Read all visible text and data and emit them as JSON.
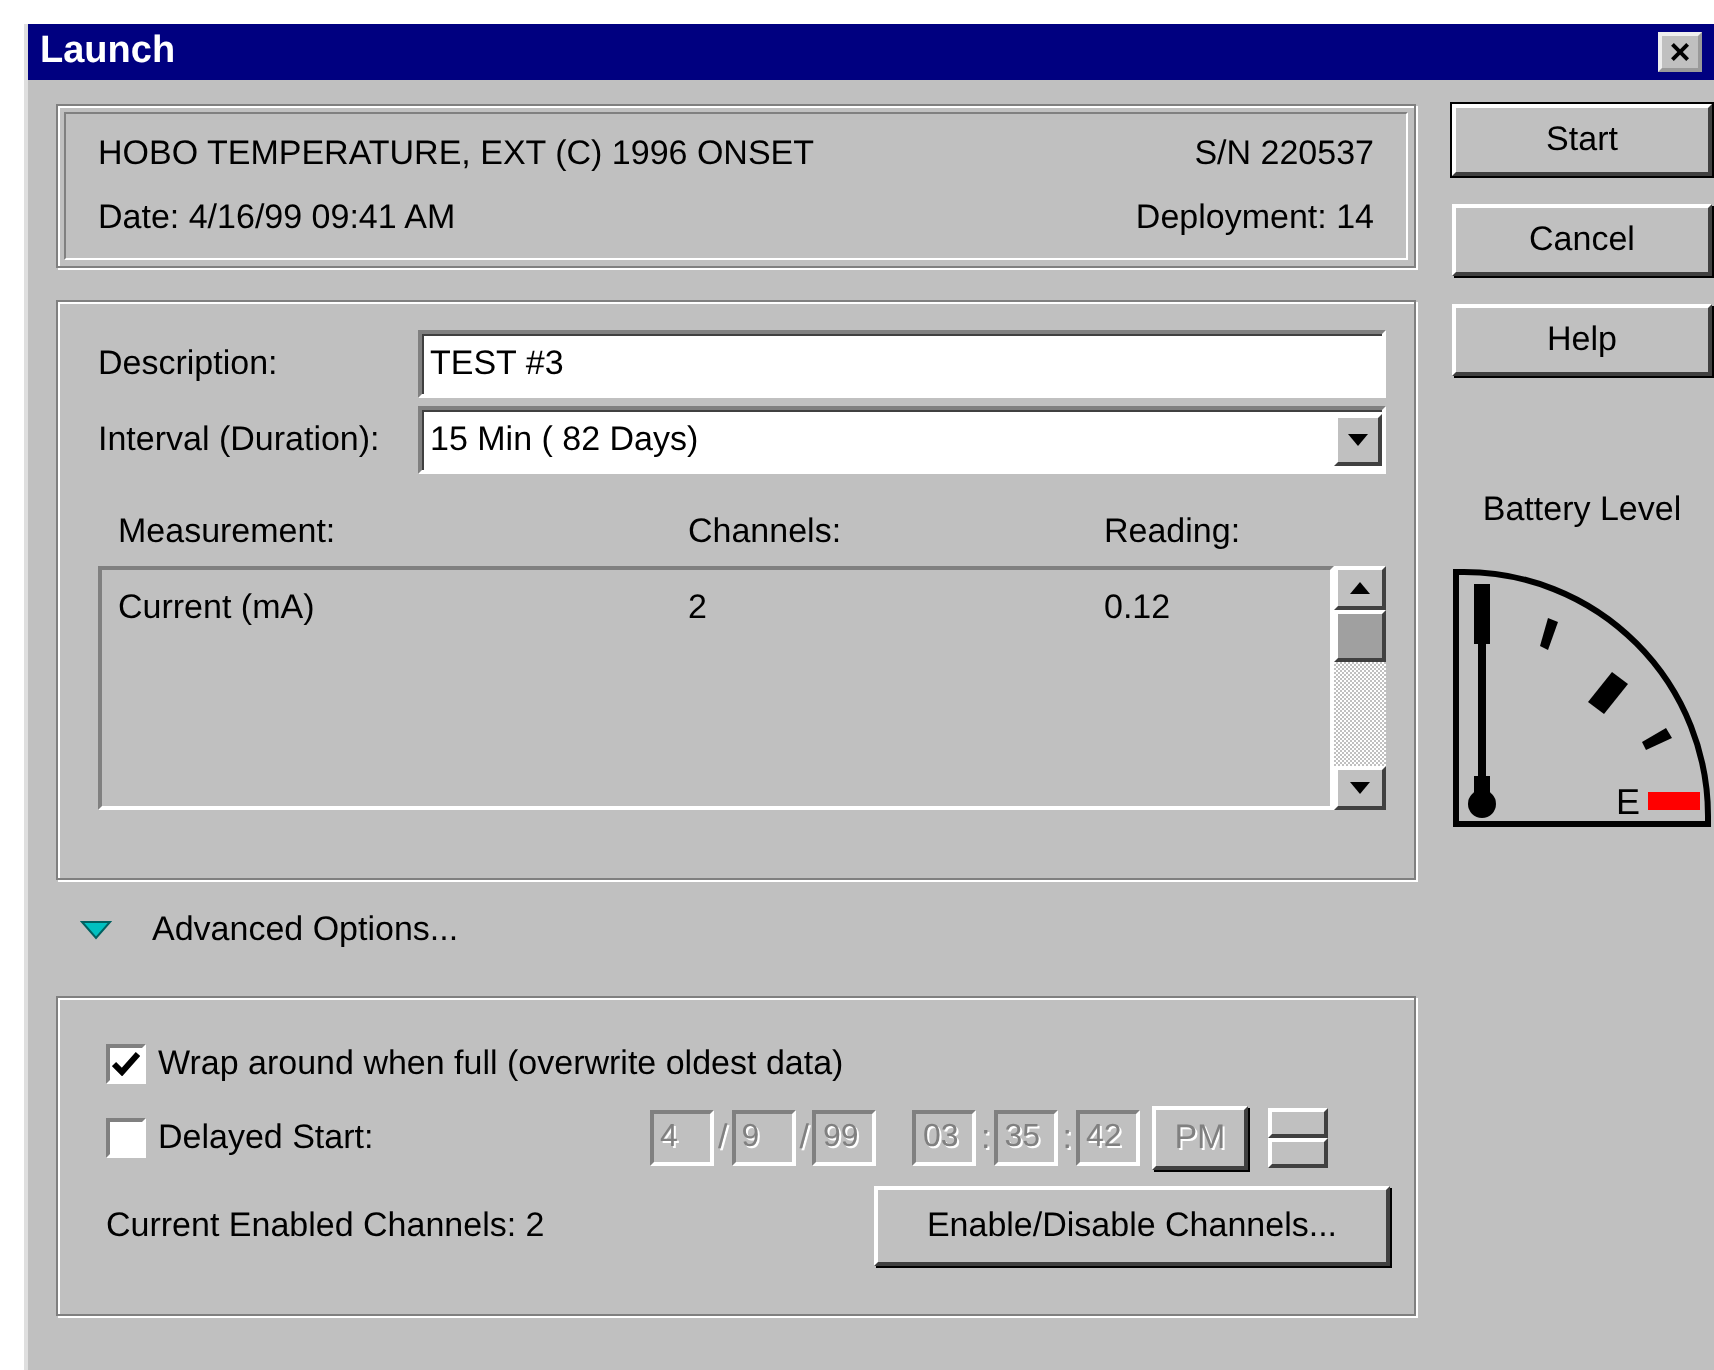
{
  "window": {
    "title": "Launch",
    "close": "×"
  },
  "device": {
    "name": "HOBO TEMPERATURE, EXT (C) 1996 ONSET",
    "serial": "S/N 220537",
    "date": "Date:  4/16/99 09:41 AM",
    "deployment": "Deployment: 14"
  },
  "description": {
    "label": "Description:",
    "value": "TEST #3"
  },
  "interval": {
    "label": "Interval (Duration):",
    "value": "15 Min ( 82 Days)"
  },
  "measurements": {
    "columns": [
      "Measurement:",
      "Channels:",
      "Reading:"
    ],
    "rows": [
      [
        "Current (mA)",
        "2",
        "0.12"
      ]
    ]
  },
  "advanced": {
    "label": "Advanced Options...",
    "expanded": true
  },
  "wrap": {
    "label": "Wrap around when full (overwrite oldest data)",
    "checked": true
  },
  "delayed": {
    "label": "Delayed Start:",
    "checked": false,
    "date": [
      "4",
      "9",
      "99"
    ],
    "date_sep": "/",
    "time": [
      "03",
      "35",
      "42"
    ],
    "time_sep": ":",
    "ampm": "PM"
  },
  "enabled_channels": "Current Enabled Channels:  2",
  "channels_button": "Enable/Disable Channels...",
  "buttons": [
    "Start",
    "Cancel",
    "Help"
  ],
  "battery": {
    "label": "Battery Level",
    "empty_mark": "E"
  }
}
